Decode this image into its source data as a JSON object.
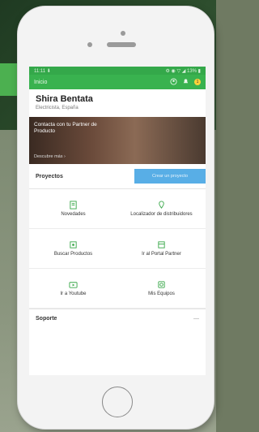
{
  "status_bar": {
    "time": "11:11 ⬇",
    "indicators": "⚙ ◉ ▽ ◢ 13% ▮"
  },
  "appbar": {
    "title": "Inicio",
    "notification_count": "1"
  },
  "profile": {
    "name": "Shira Bentata",
    "role": "Electricista, España"
  },
  "banner": {
    "title": "Contacta con tu Partner de Producto",
    "cta": "Descubre más ›"
  },
  "projects": {
    "label": "Proyectos",
    "button": "Crear un proyecto"
  },
  "tiles": [
    {
      "label": "Novedades",
      "icon": "news-icon"
    },
    {
      "label": "Localizador de distribuidores",
      "icon": "location-icon"
    },
    {
      "label": "Buscar Productos",
      "icon": "search-products-icon"
    },
    {
      "label": "Ir al Portal Partner",
      "icon": "portal-icon"
    },
    {
      "label": "Ir a Youtube",
      "icon": "youtube-icon"
    },
    {
      "label": "Mis Equipos",
      "icon": "equipment-icon"
    }
  ],
  "support": {
    "label": "Soporte",
    "indicator": "—"
  }
}
